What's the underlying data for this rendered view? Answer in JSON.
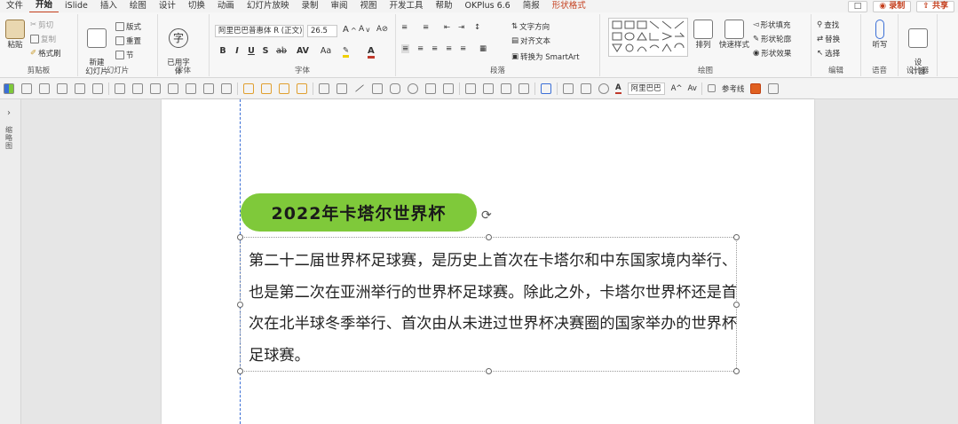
{
  "menu": {
    "items": [
      "文件",
      "开始",
      "iSlide",
      "插入",
      "绘图",
      "设计",
      "切换",
      "动画",
      "幻灯片放映",
      "录制",
      "审阅",
      "视图",
      "开发工具",
      "帮助",
      "OKPlus 6.6",
      "简报",
      "形状格式"
    ],
    "active_index": 1,
    "context_index": 16,
    "comment_icon": "comment-icon",
    "record_label": "录制",
    "share_label": "共享"
  },
  "ribbon": {
    "clipboard": {
      "paste": "粘贴",
      "cut": "剪切",
      "copy": "复制",
      "format_painter": "格式刷",
      "label": "剪贴板"
    },
    "slides": {
      "new_slide": "新建\n幻灯片",
      "layout": "版式",
      "reset": "重置",
      "section": "节",
      "label": "幻灯片"
    },
    "font_group": {
      "use_font": "已用字\n体",
      "label": "字体"
    },
    "font": {
      "name": "阿里巴巴普惠体 R (正文)",
      "size": "26.5",
      "label": "字体",
      "bold": "B",
      "italic": "I",
      "underline": "U",
      "strike": "S",
      "strike2": "ab",
      "spacing": "AV",
      "case": "Aa",
      "color_accent": "#f0d000",
      "font_color_accent": "#c0392b"
    },
    "paragraph": {
      "direction": "文字方向",
      "align_text": "对齐文本",
      "smartart": "转换为 SmartArt",
      "label": "段落"
    },
    "drawing": {
      "arrange": "排列",
      "quick_styles": "快速样式",
      "fill": "形状填充",
      "outline": "形状轮廓",
      "effects": "形状效果",
      "label": "绘图"
    },
    "editing": {
      "find": "查找",
      "replace": "替换",
      "select": "选择",
      "label": "编辑"
    },
    "voice": {
      "dictate": "听写",
      "label": "语音"
    },
    "designer": {
      "designer": "设\n计器",
      "label": "设计器"
    }
  },
  "qat": {
    "font_name": "阿里巴巴",
    "guides_label": "参考线"
  },
  "left_panel": {
    "label": "缩略图"
  },
  "slide": {
    "title": "2022年卡塔尔世界杯",
    "title_bg": "#7fc93a",
    "body": "第二十二届世界杯足球赛，是历史上首次在卡塔尔和中东国家境内举行、也是第二次在亚洲举行的世界杯足球赛。除此之外，卡塔尔世界杯还是首次在北半球冬季举行、首次由从未进过世界杯决赛圈的国家举办的世界杯足球赛。"
  },
  "colors": {
    "accent": "#c43e1c",
    "guide": "#3b6fd6"
  }
}
